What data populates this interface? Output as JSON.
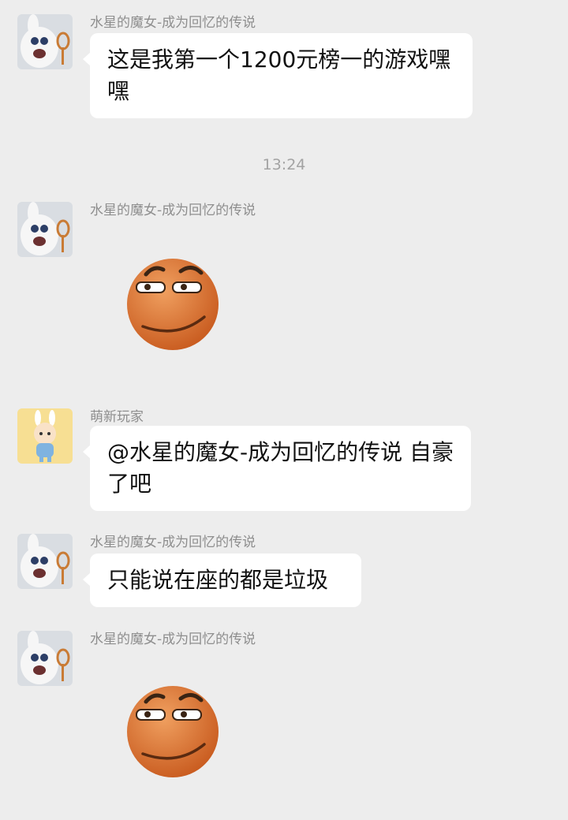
{
  "messages": [
    {
      "sender": "水星的魔女-成为回忆的传说",
      "text": "这是我第一个1200元榜一的游戏嘿嘿"
    },
    {
      "sender": "水星的魔女-成为回忆的传说",
      "sticker": "smirk-face-sticker"
    },
    {
      "sender": "萌新玩家",
      "text": "@水星的魔女-成为回忆的传说 自豪了吧"
    },
    {
      "sender": "水星的魔女-成为回忆的传说",
      "text": "只能说在座的都是垃圾"
    },
    {
      "sender": "水星的魔女-成为回忆的传说",
      "sticker": "smirk-face-sticker"
    }
  ],
  "timestamp": "13:24",
  "colors": {
    "background": "#ededed",
    "bubble": "#ffffff",
    "sender": "#8e8e8e",
    "timestamp": "#a3a3a3"
  }
}
